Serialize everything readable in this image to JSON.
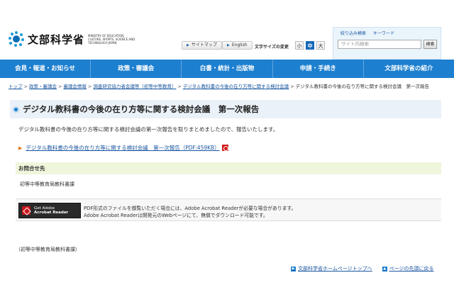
{
  "header": {
    "logo_text": "文部科学省",
    "logo_sub": "MINISTRY OF EDUCATION, CULTURE, SPORTS, SCIENCE AND TECHNOLOGY-JAPAN",
    "sitemap_label": "サイトマップ",
    "english_label": "English",
    "font_size_label": "文字サイズの変更",
    "font_sizes": [
      "小",
      "中",
      "大"
    ],
    "search_links": [
      "絞り込み検索",
      "キーワード"
    ],
    "search_placeholder": "サイト内検索",
    "search_button": "検索"
  },
  "nav": {
    "items": [
      "会見・報道・お知らせ",
      "政策・審議会",
      "白書・統計・出版物",
      "申請・手続き",
      "文部科学省の紹介"
    ]
  },
  "breadcrumb": [
    "トップ",
    "政策・審議会",
    "審議会情報",
    "調査研究協力者会議等（初等中等教育）",
    "デジタル教科書の今後の在り方等に関する検討会議",
    "デジタル教科書の今後の在り方等に関する検討会議　第一次報告"
  ],
  "main": {
    "title": "デジタル教科書の今後の在り方等に関する検討会議　第一次報告",
    "intro": "デジタル教科書の今後の在り方等に関する検討会議の第一次報告を取りまとめましたので、報告いたします。",
    "report_link": "デジタル教科書の今後の在り方等に関する検討会議　第一次報告（PDF:459KB）",
    "contact_heading": "お問合せ先",
    "contact_dept": "初等中等教育局教科書課",
    "reader_badge_line1": "Get Adobe",
    "reader_badge_line2": "Acrobat Reader",
    "reader_note1": "PDF形式のファイルを御覧いただく場合には、Adobe Acrobat Readerが必要な場合があります。",
    "reader_note2": "Adobe Acrobat Readerは開発元のWebページにて、無償でダウンロード可能です。",
    "footer_dept": "（初等中等教育局教科書課）"
  },
  "footer": {
    "home_link": "文部科学省ホームページトップへ",
    "top_link": "ページの先頭に戻る"
  }
}
